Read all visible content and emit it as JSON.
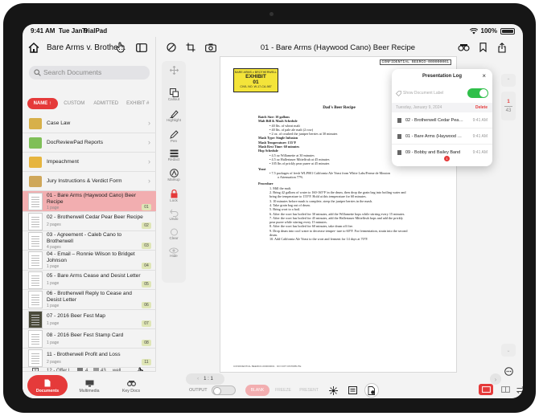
{
  "status_bar": {
    "time": "9:41 AM",
    "date": "Tue Jan 9",
    "app_name": "TrialPad",
    "battery": "100%"
  },
  "sidebar": {
    "case_title": "Bare Arms v. Brothe…",
    "search_placeholder": "Search Documents",
    "sort_tabs": [
      {
        "label": "NAME ↑",
        "active": true
      },
      {
        "label": "CUSTOM",
        "active": false
      },
      {
        "label": "ADMITTED",
        "active": false
      },
      {
        "label": "EXHIBIT #",
        "active": false
      }
    ],
    "folders": [
      {
        "title": "Case Law",
        "color": "#d7b04a"
      },
      {
        "title": "DocReviewPad Reports",
        "color": "#7fbf58"
      },
      {
        "title": "Impeachment",
        "color": "#e6b53f"
      },
      {
        "title": "Jury Instructions & Verdict Form",
        "color": "#cfa75a"
      }
    ],
    "documents": [
      {
        "title": "01 - Bare Arms (Haywood Cano) Beer Recipe",
        "pages": "1 page",
        "num": "01",
        "selected": true
      },
      {
        "title": "02 - Brotherwell Cedar Pear Beer Recipe",
        "pages": "2 pages",
        "num": "02",
        "selected": false
      },
      {
        "title": "03 - Agreement - Caleb Cano to Brotherwell",
        "pages": "4 pages",
        "num": "03",
        "selected": false
      },
      {
        "title": "04 - Email – Ronnie Wilson to Bridget Johnson",
        "pages": "1 page",
        "num": "04",
        "selected": false
      },
      {
        "title": "05 - Bare Arms Cease and Desist Letter",
        "pages": "1 page",
        "num": "05",
        "selected": false
      },
      {
        "title": "06 - Brotherwell Reply to Cease and Desist Letter",
        "pages": "1 page",
        "num": "06",
        "selected": false
      },
      {
        "title": "07 - 2016 Beer Fest Map",
        "pages": "1 page",
        "num": "07",
        "selected": false
      },
      {
        "title": "08 - 2016 Beer Fest Stamp Card",
        "pages": "1 page",
        "num": "08",
        "selected": false
      },
      {
        "title": "11 - Brotherwell Profit and Loss",
        "pages": "2 pages",
        "num": "11",
        "selected": false
      }
    ],
    "stack_row": {
      "title": "12 - Offer L",
      "count_a": "4",
      "count_b": "43",
      "suffix": "well"
    },
    "tabs": [
      {
        "label": "Documents",
        "active": true
      },
      {
        "label": "Multimedia",
        "active": false
      },
      {
        "label": "Key Docs",
        "active": false
      }
    ]
  },
  "main": {
    "document_title": "01 - Bare Arms (Haywood Cano) Beer Recipe",
    "tools": [
      {
        "label": ""
      },
      {
        "label": "Callout"
      },
      {
        "label": "Highlight"
      },
      {
        "label": "Pen"
      },
      {
        "label": "Redact"
      },
      {
        "label": "Markup"
      },
      {
        "label": "Lock"
      },
      {
        "label": "Undo"
      },
      {
        "label": "Clear"
      },
      {
        "label": "Hide"
      }
    ],
    "page_indicator": "1 : 1",
    "rail": {
      "current": "1",
      "total": "43"
    }
  },
  "document": {
    "confidential": "CONFIDENTIAL BEERCO-000000001",
    "exhibit_top": "BARE ARMS v BROTHERWELL",
    "exhibit_label": "EXHIBIT",
    "exhibit_number": "01",
    "exhibit_bottom": "CIVIL NO. W-17-CA-987",
    "title": "Dad's Beer Recipe",
    "lines": [
      {
        "text": "Batch Size: 10 gallons",
        "style": "b"
      },
      {
        "text": "Malt Bill & Mash Schedule",
        "style": "b"
      },
      {
        "text": "•  40 lbs. of wheat malt",
        "style": "in"
      },
      {
        "text": "•  40 lbs. of pale ale malt (2 row)",
        "style": "in"
      },
      {
        "text": "•  2 oz. of crushed the juniper berries at 30 minutes",
        "style": "in"
      },
      {
        "text": "Mash Type: Single Infusion",
        "style": "b"
      },
      {
        "text": "Mash Temperature: 155°F",
        "style": "b"
      },
      {
        "text": "Mash Rest Time: 60 minutes",
        "style": "b"
      },
      {
        "text": "Hop Schedule",
        "style": "b"
      },
      {
        "text": "•  4.5 oz Willamette at 30 minutes",
        "style": "in"
      },
      {
        "text": "•  4.5 oz Hallertauer Mittelfruh at 45 minutes",
        "style": "in"
      },
      {
        "text": "•  105 lbs of prickly pear puree at 45 minutes",
        "style": "in"
      },
      {
        "text": "Yeast",
        "style": "b"
      },
      {
        "text": "•  7.5 packages of fresh WLP001 California Ale Yeast from White Labs/Ferme de Mouton",
        "style": "in"
      },
      {
        "text": "o  Attenuation 77%",
        "style": "in2"
      },
      {
        "text": "Procedure",
        "style": "b"
      },
      {
        "text": "1.  Mill the malt.",
        "style": "in"
      },
      {
        "text": "2.  Bring 42 gallons of water to 160-165°F in the drum, then drop the grain bag into boiling water and",
        "style": "in"
      },
      {
        "text": "     bring the temperature to 155°F. Hold at this temperature for 60 minutes.",
        "style": "in"
      },
      {
        "text": "3.  10 minutes before mash is complete, steep the juniper berries in the mash.",
        "style": "in"
      },
      {
        "text": "4.  Take grain bag out of drum.",
        "style": "in"
      },
      {
        "text": "5.  Bring wort to a boil.",
        "style": "in"
      },
      {
        "text": "6.  After the wort has boiled for 30 minutes, add the Willamette hops while stirring every 15 minutes.",
        "style": "in"
      },
      {
        "text": "7.  After the wort has boiled for 45 minutes, add the Hallertauer Mittelfruh hops and add the prickly",
        "style": "in"
      },
      {
        "text": "     pear puree while stirring every 15 minutes.",
        "style": "in"
      },
      {
        "text": "8.  After the wort has boiled for 60 minutes, take drum off fire.",
        "style": "in"
      },
      {
        "text": "9.  Drop drum into cool water to decrease temper- ture to 60°F. For fermentation, strain into the second",
        "style": "in"
      },
      {
        "text": "     drum.",
        "style": "in"
      },
      {
        "text": "10. Add California Ale Yeast to the wort and ferment for 14 days at 70°F.",
        "style": "in"
      }
    ],
    "footer": "CONFIDENTIAL BEERCO-000000001 · DO NOT DISTRIBUTE"
  },
  "bottom_bar": {
    "output_label": "OUTPUT",
    "blank": "BLANK",
    "freeze": "FREEZE",
    "present": "PRESENT"
  },
  "presentation_log": {
    "title": "Presentation Log",
    "show_label": "Show Document Label",
    "show_label_on": true,
    "date": "Tuesday, January 9, 2024",
    "delete": "Delete",
    "items": [
      {
        "name": "02 - Brotherwell Cedar Pear…",
        "time": "9:41 AM"
      },
      {
        "name": "01 - Bare Arms (Haywood Ca…",
        "time": "9:41 AM"
      },
      {
        "name": "09 - Bobby and Bailey Band",
        "time": "9:41 AM"
      }
    ],
    "badge": "1"
  },
  "colors": {
    "accent": "#e53a3a",
    "selected_row": "#f2aeb0",
    "exhibit_sticker": "#f4e43a",
    "toggle_on": "#2fbf4a"
  }
}
